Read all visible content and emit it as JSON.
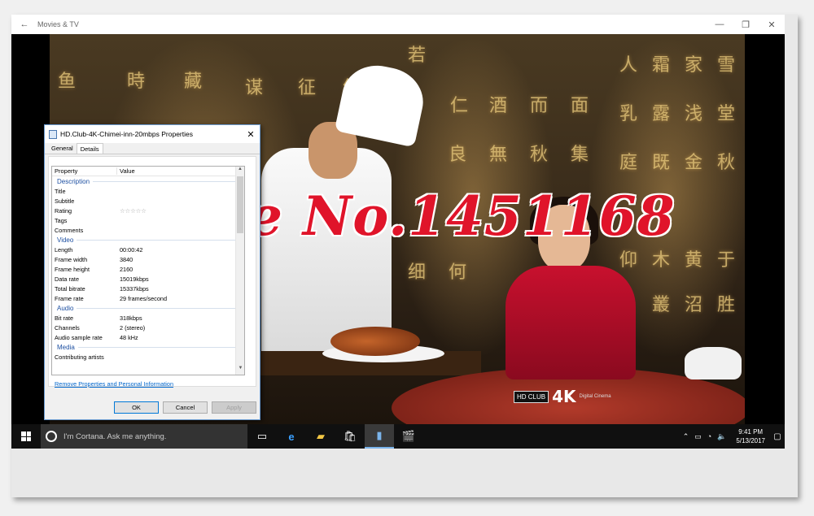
{
  "window": {
    "back_icon": "back-arrow-icon",
    "title": "Movies & TV",
    "minimize": "—",
    "restore": "❐",
    "close": "✕"
  },
  "dialog": {
    "title": "HD.Club-4K-Chimei-inn-20mbps Properties",
    "close": "✕",
    "tabs": [
      "General",
      "Details"
    ],
    "active_tab": "Details",
    "columns": {
      "property": "Property",
      "value": "Value"
    },
    "groups": {
      "description": {
        "label": "Description",
        "rows": [
          {
            "key": "Title",
            "value": ""
          },
          {
            "key": "Subtitle",
            "value": ""
          },
          {
            "key": "Rating",
            "value": "☆☆☆☆☆"
          },
          {
            "key": "Tags",
            "value": ""
          },
          {
            "key": "Comments",
            "value": ""
          }
        ]
      },
      "video": {
        "label": "Video",
        "rows": [
          {
            "key": "Length",
            "value": "00:00:42"
          },
          {
            "key": "Frame width",
            "value": "3840"
          },
          {
            "key": "Frame height",
            "value": "2160"
          },
          {
            "key": "Data rate",
            "value": "15019kbps"
          },
          {
            "key": "Total bitrate",
            "value": "15337kbps"
          },
          {
            "key": "Frame rate",
            "value": "29 frames/second"
          }
        ]
      },
      "audio": {
        "label": "Audio",
        "rows": [
          {
            "key": "Bit rate",
            "value": "318kbps"
          },
          {
            "key": "Channels",
            "value": "2 (stereo)"
          },
          {
            "key": "Audio sample rate",
            "value": "48 kHz"
          }
        ]
      },
      "media": {
        "label": "Media",
        "rows": [
          {
            "key": "Contributing artists",
            "value": ""
          }
        ]
      }
    },
    "remove_link": "Remove Properties and Personal Information",
    "buttons": {
      "ok": "OK",
      "cancel": "Cancel",
      "apply": "Apply"
    }
  },
  "video": {
    "watermark": "Store No.1451168",
    "logo_text": "HD CLUB",
    "logo_4k": "4K",
    "logo_small": "Digital Cinema"
  },
  "taskbar": {
    "search_placeholder": "I'm Cortana. Ask me anything.",
    "time": "9:41 PM",
    "date": "5/13/2017",
    "pinned": [
      "task-view-icon",
      "edge-icon",
      "file-explorer-icon",
      "store-icon",
      "document-icon",
      "movies-tv-icon"
    ],
    "tray": [
      "chevron-up-icon",
      "battery-icon",
      "network-icon",
      "volume-icon"
    ]
  },
  "colors": {
    "accent": "#0078d7",
    "watermark": "#e0142a",
    "group_header": "#1e50a2",
    "link": "#0066cc"
  }
}
